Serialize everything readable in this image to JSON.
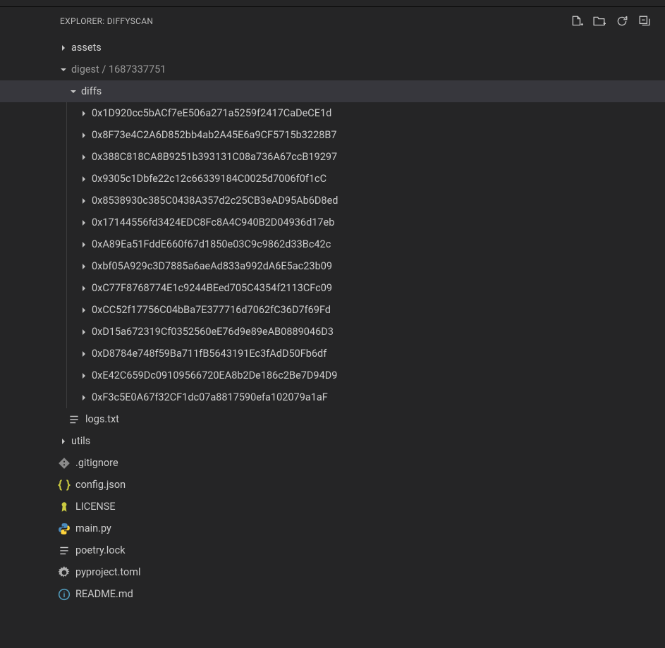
{
  "explorer": {
    "title": "EXPLORER: DIFFYSCAN",
    "folders": {
      "assets": "assets",
      "digest": "digest",
      "digest_sub": "1687337751",
      "diffs": "diffs",
      "utils": "utils"
    },
    "diff_items": [
      "0x1D920cc5bACf7eE506a271a5259f2417CaDeCE1d",
      "0x8F73e4C2A6D852bb4ab2A45E6a9CF5715b3228B7",
      "0x388C818CA8B9251b393131C08a736A67ccB19297",
      "0x9305c1Dbfe22c12c66339184C0025d7006f0f1cC",
      "0x8538930c385C0438A357d2c25CB3eAD95Ab6D8ed",
      "0x17144556fd3424EDC8Fc8A4C940B2D04936d17eb",
      "0xA89Ea51FddE660f67d1850e03C9c9862d33Bc42c",
      "0xbf05A929c3D7885a6aeAd833a992dA6E5ac23b09",
      "0xC77F8768774E1c9244BEed705C4354f2113CFc09",
      "0xCC52f17756C04bBa7E377716d7062fC36D7f69Fd",
      "0xD15a672319Cf0352560eE76d9e89eAB0889046D3",
      "0xD8784e748f59Ba711fB5643191Ec3fAdD50Fb6df",
      "0xE42C659Dc09109566720EA8b2De186c2Be7D94D9",
      "0xF3c5E0A67f32CF1dc07a8817590efa102079a1aF"
    ],
    "files": {
      "logs": "logs.txt",
      "gitignore": ".gitignore",
      "config": "config.json",
      "license": "LICENSE",
      "main": "main.py",
      "poetry": "poetry.lock",
      "pyproject": "pyproject.toml",
      "readme": "README.md"
    }
  }
}
